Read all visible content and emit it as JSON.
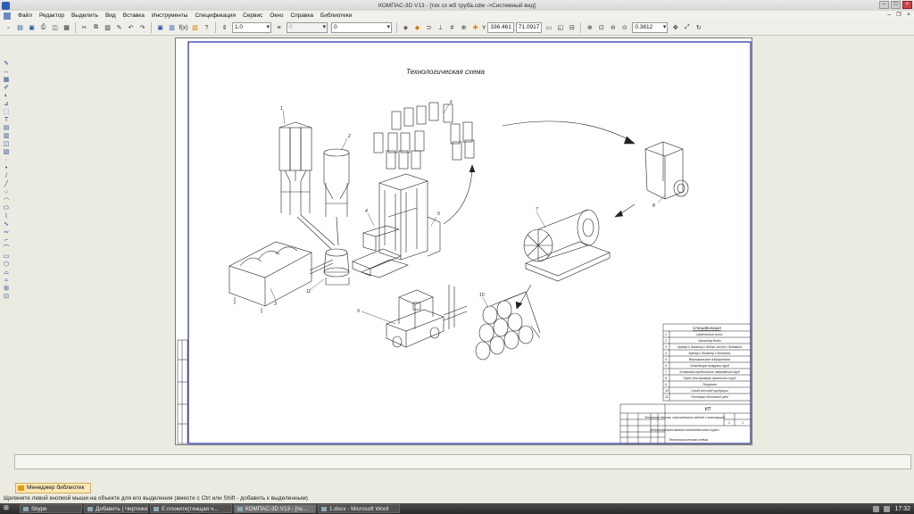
{
  "window": {
    "title": "КОМПАС-3D V13 - [тех сх жб труба.cdw ->Системный вид]"
  },
  "menu": {
    "items": [
      "Файл",
      "Редактор",
      "Выделить",
      "Вид",
      "Вставка",
      "Инструменты",
      "Спецификация",
      "Сервис",
      "Окно",
      "Справка",
      "Библиотеки"
    ]
  },
  "toolbar": {
    "scale": "1.0",
    "layer": "0",
    "style": "0",
    "coord_x": "336.461",
    "coord_y": "71.0917",
    "zoom": "0.3812",
    "x_label": "Y"
  },
  "drawing": {
    "title": "Технологическая схема",
    "callouts": [
      "1",
      "2",
      "3",
      "4",
      "5",
      "6",
      "7",
      "8",
      "9",
      "10",
      "11"
    ],
    "spec": {
      "header": "Спецификация",
      "rows": [
        {
          "num": "1",
          "name": "Цементные силос"
        },
        {
          "num": "2",
          "name": "Заглетер Воды"
        },
        {
          "num": "3",
          "name": "Бункер и дозатор с добав. отсев с добавкой"
        },
        {
          "num": "4",
          "name": "Бункер и дозатор с Бетоном"
        },
        {
          "num": "5",
          "name": "Вертикальные виброуплотн"
        },
        {
          "num": "6",
          "name": "Отводящие выгрузки труб"
        },
        {
          "num": "7",
          "name": "Установка продольного напряжения труб"
        },
        {
          "num": "8",
          "name": "Пресс для проверки прочности труб"
        },
        {
          "num": "9",
          "name": "Погрузчик"
        },
        {
          "num": "10",
          "name": "Склад готовой продукции"
        },
        {
          "num": "11",
          "name": "Растворо-бетонный узел"
        }
      ]
    },
    "stamp": {
      "code": "КП",
      "project": "Технология бетона, строительных изделий и конструкций",
      "doc": "Виброгидропрессованные железобетонные трубы",
      "sheet": "Технологическая схема",
      "sheet_no": "1",
      "sheets": "1"
    }
  },
  "library_tab": {
    "label": "Менеджер библиотек"
  },
  "status": {
    "text": "Щелкните левой кнопкой мыши на объекте для его выделения (вместе с Ctrl или Shift - добавить к выделенным)"
  },
  "taskbar": {
    "tasks": [
      "Skype",
      "Добавить | Чертежи ...",
      "Е.плоките(тянщая ч...",
      "КОМПАС-3D V13 - [те...",
      "1.docx - Microsoft Word"
    ],
    "clock": "17:32"
  },
  "colors": {
    "frame": "#1e2aa8",
    "sheet": "#ffffff",
    "workspace": "#ecebe2"
  }
}
